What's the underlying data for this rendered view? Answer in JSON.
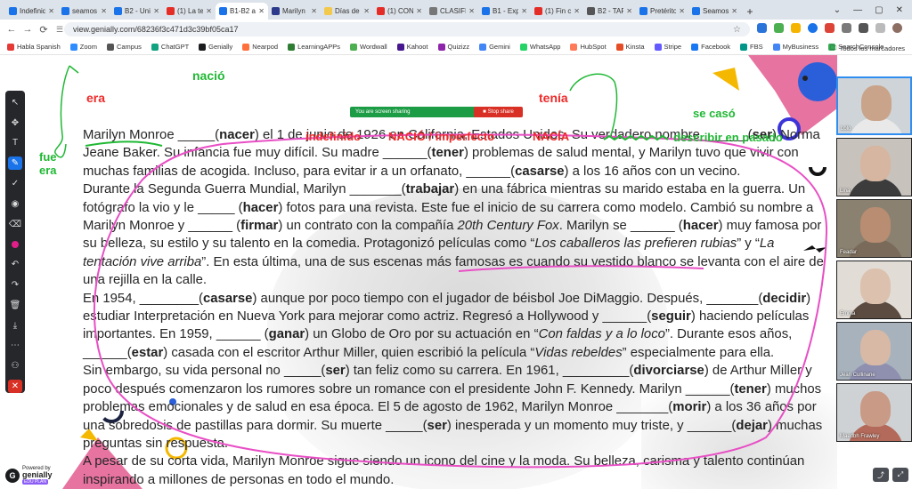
{
  "browser": {
    "tabs": [
      {
        "label": "Indefinido",
        "color": "#1a73e8",
        "active": false
      },
      {
        "label": "seamos",
        "color": "#1a73e8",
        "active": false
      },
      {
        "label": "B2 - Unid",
        "color": "#1a73e8",
        "active": false
      },
      {
        "label": "(1) La ter",
        "color": "#e52d27",
        "active": false
      },
      {
        "label": "B1-B2 a",
        "color": "#1a73e8",
        "active": true
      },
      {
        "label": "Marilyn",
        "color": "#2d3a8c",
        "active": false
      },
      {
        "label": "Días de",
        "color": "#f2c94c",
        "active": false
      },
      {
        "label": "(1) CON",
        "color": "#e52d27",
        "active": false
      },
      {
        "label": "CLASIFIC",
        "color": "#777777",
        "active": false
      },
      {
        "label": "B1 - Exp",
        "color": "#1a73e8",
        "active": false
      },
      {
        "label": "(1) Fin cl",
        "color": "#e52d27",
        "active": false
      },
      {
        "label": "B2 - TAR",
        "color": "#555555",
        "active": false
      },
      {
        "label": "Pretérito",
        "color": "#1a73e8",
        "active": false
      },
      {
        "label": "Seamos",
        "color": "#1a73e8",
        "active": false
      }
    ],
    "new_tab": "+",
    "window_controls": [
      "⌄",
      "—",
      "▢",
      "✕"
    ],
    "url": "view.genially.com/68236f3c471d3c39bf05ca17",
    "bookmarks": [
      "Habla Spanish",
      "Zoom",
      "Campus",
      "ChatGPT",
      "Genially",
      "Nearpod",
      "LearningAPPs",
      "Wordwall",
      "Kahoot",
      "Quizizz",
      "Gemini",
      "WhatsApp",
      "HubSpot",
      "Kinsta",
      "Stripe",
      "Facebook",
      "FBS",
      "MyBusiness",
      "SearchConsole"
    ],
    "all_bookmarks": "Todos los marcadores"
  },
  "share": {
    "banner": "You are screen sharing",
    "stop": "Stop share"
  },
  "annotations": {
    "nacio": "nació",
    "era": "era",
    "tenia": "tenía",
    "se_caso": "se casó",
    "fue": "fue",
    "era2": "era",
    "indefinido": "indefinido",
    "nacio_imperfecto": "NACIÓ / imperfecto",
    "nacia": "NACÍA",
    "describir": "describir en pasado"
  },
  "participants": [
    {
      "name": "Lolo"
    },
    {
      "name": "Lina"
    },
    {
      "name": "Feadar"
    },
    {
      "name": "Emma"
    },
    {
      "name": "Jean Cullinane"
    },
    {
      "name": "Maedbh Frawley"
    }
  ],
  "genially": {
    "powered": "Powered by",
    "name": "genially",
    "plan": "EDU PLAN"
  }
}
